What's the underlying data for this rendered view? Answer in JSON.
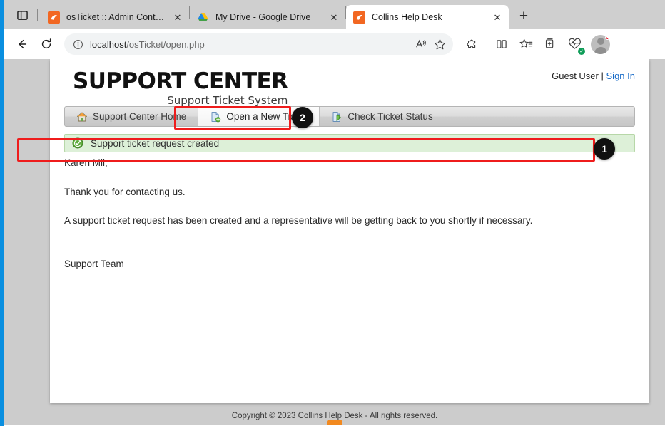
{
  "browser": {
    "tabs": [
      {
        "title": "osTicket :: Admin Control Panel",
        "favicon": "osticket-icon",
        "active": false
      },
      {
        "title": "My Drive - Google Drive",
        "favicon": "google-drive-icon",
        "active": false
      },
      {
        "title": "Collins Help Desk",
        "favicon": "osticket-icon",
        "active": true
      }
    ],
    "new_tab_label": "+",
    "minimize_label": "—",
    "back_label": "←",
    "reload_label": "↻",
    "address": {
      "host": "localhost",
      "path": "/osTicket/open.php",
      "full": "localhost/osTicket/open.php"
    },
    "toolbar_icons": [
      "read-aloud-icon",
      "favorite-star-icon",
      "extensions-icon",
      "split-screen-icon",
      "favorites-list-icon",
      "collections-icon",
      "browser-essentials-icon"
    ],
    "profile": {
      "name": "avatar",
      "has_notification": true
    }
  },
  "site": {
    "logo_title": "SUPPORT CENTER",
    "logo_subtitle": "Support Ticket System",
    "user_label": "Guest User",
    "user_separator": "|",
    "signin_label": "Sign In",
    "nav": [
      {
        "label": "Support Center Home",
        "icon": "home-icon",
        "active": false
      },
      {
        "label": "Open a New Ticket",
        "icon": "new-document-icon",
        "active": true
      },
      {
        "label": "Check Ticket Status",
        "icon": "ticket-status-icon",
        "active": false
      }
    ],
    "alert": {
      "icon": "success-check-icon",
      "message": "Support ticket request created"
    },
    "body": {
      "greeting": "Karen Mil,",
      "line1": "Thank you for contacting us.",
      "line2": "A support ticket request has been created and a representative will be getting back to you shortly if necessary.",
      "signature": "Support Team"
    },
    "footer": "Copyright © 2023 Collins Help Desk - All rights reserved."
  },
  "annotations": {
    "callout_1": "1",
    "callout_2": "2"
  },
  "colors": {
    "highlight": "#ef1c1c",
    "callout_bg": "#101010",
    "link": "#1569c7",
    "alert_bg": "#ddf0d8",
    "alert_border": "#b7d7a8",
    "favicon_orange": "#f26722",
    "desktop_blue": "#0a8fe0"
  }
}
